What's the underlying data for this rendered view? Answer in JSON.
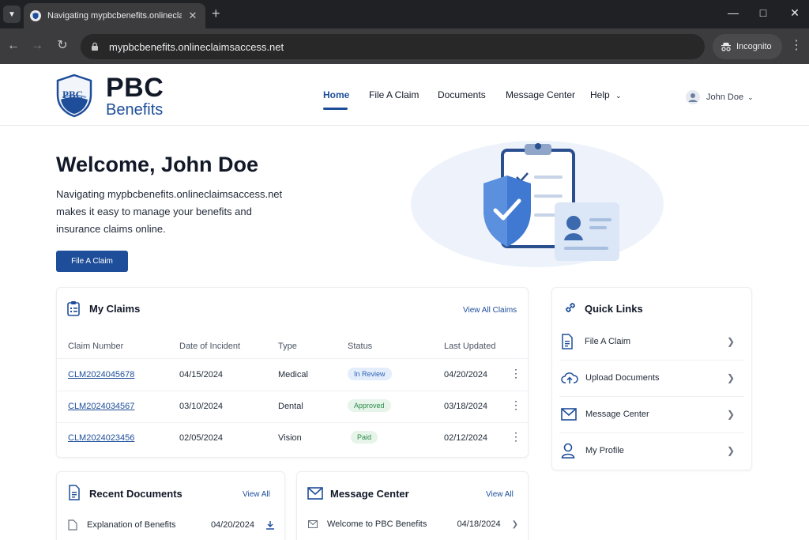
{
  "browser": {
    "tab_title": "Navigating mypbcbenefits.onlineclaim",
    "url": "mypbcbenefits.onlineclaimsaccess.net",
    "incognito_label": "Incognito"
  },
  "brand": {
    "shield_text": "PBC",
    "title": "PBC",
    "subtitle": "Benefits"
  },
  "nav": {
    "home": "Home",
    "file_claim": "File A Claim",
    "documents": "Documents",
    "message_center": "Message Center",
    "help": "Help"
  },
  "user": {
    "name": "John Doe"
  },
  "hero": {
    "title": "Welcome, John Doe",
    "line1": "Navigating mypbcbenefits.onlineclaimsaccess.net",
    "line2": "makes it easy to manage your benefits and",
    "line3": "insurance claims online.",
    "button": "File A Claim"
  },
  "claims": {
    "title": "My Claims",
    "view_all": "View All Claims",
    "headers": [
      "Claim Number",
      "Date of Incident",
      "Type",
      "Status",
      "Last Updated"
    ],
    "rows": [
      {
        "number": "CLM2024045678",
        "date": "04/15/2024",
        "type": "Medical",
        "status": "In Review",
        "updated": "04/20/2024"
      },
      {
        "number": "CLM2024034567",
        "date": "03/10/2024",
        "type": "Dental",
        "status": "Approved",
        "updated": "03/18/2024"
      },
      {
        "number": "CLM2024023456",
        "date": "02/05/2024",
        "type": "Vision",
        "status": "Paid",
        "updated": "02/12/2024"
      }
    ]
  },
  "quick_links": {
    "title": "Quick Links",
    "items": [
      "File A Claim",
      "Upload Documents",
      "Message Center",
      "My Profile"
    ]
  },
  "documents": {
    "title": "Recent Documents",
    "view_all": "View All",
    "first_name": "Explanation of Benefits",
    "first_date": "04/20/2024"
  },
  "messages": {
    "title": "Message Center",
    "view_all": "View All",
    "first_subject": "Welcome to PBC Benefits",
    "first_date": "04/18/2024"
  },
  "colors": {
    "primary": "#1e4e9a",
    "in_review_bg": "#e3edfb",
    "in_review_text": "#2f64b6",
    "approved_bg": "#e6f4ea",
    "approved_text": "#2f8a4b",
    "paid_bg": "#e6f4ea",
    "paid_text": "#2f8a4b"
  }
}
